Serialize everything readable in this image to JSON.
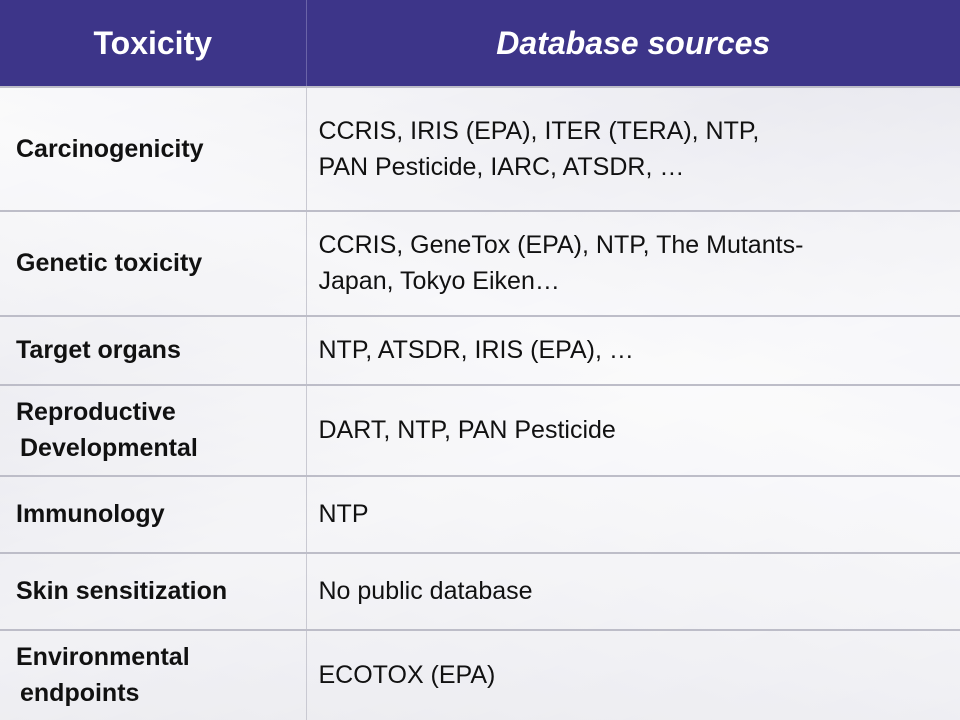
{
  "table": {
    "headers": [
      "Toxicity",
      "Database sources"
    ],
    "rows": [
      {
        "toxicity": [
          "Carcinogenicity"
        ],
        "sources": [
          "CCRIS, IRIS (EPA), ITER (TERA), NTP,",
          "PAN Pesticide, IARC, ATSDR, …"
        ]
      },
      {
        "toxicity": [
          "Genetic toxicity"
        ],
        "sources": [
          "CCRIS, GeneTox (EPA), NTP, The Mutants-",
          "Japan, Tokyo Eiken…"
        ]
      },
      {
        "toxicity": [
          "Target organs"
        ],
        "sources": [
          "NTP, ATSDR, IRIS (EPA), …"
        ]
      },
      {
        "toxicity": [
          "Reproductive",
          "Developmental"
        ],
        "sources": [
          "DART, NTP, PAN Pesticide"
        ]
      },
      {
        "toxicity": [
          "Immunology"
        ],
        "sources": [
          "NTP"
        ]
      },
      {
        "toxicity": [
          "Skin sensitization"
        ],
        "sources": [
          "No public database"
        ]
      },
      {
        "toxicity": [
          "Environmental",
          "endpoints"
        ],
        "sources": [
          "ECOTOX (EPA)"
        ]
      }
    ]
  },
  "colors": {
    "header_bg": "#3d3589",
    "header_text": "#ffffff"
  }
}
